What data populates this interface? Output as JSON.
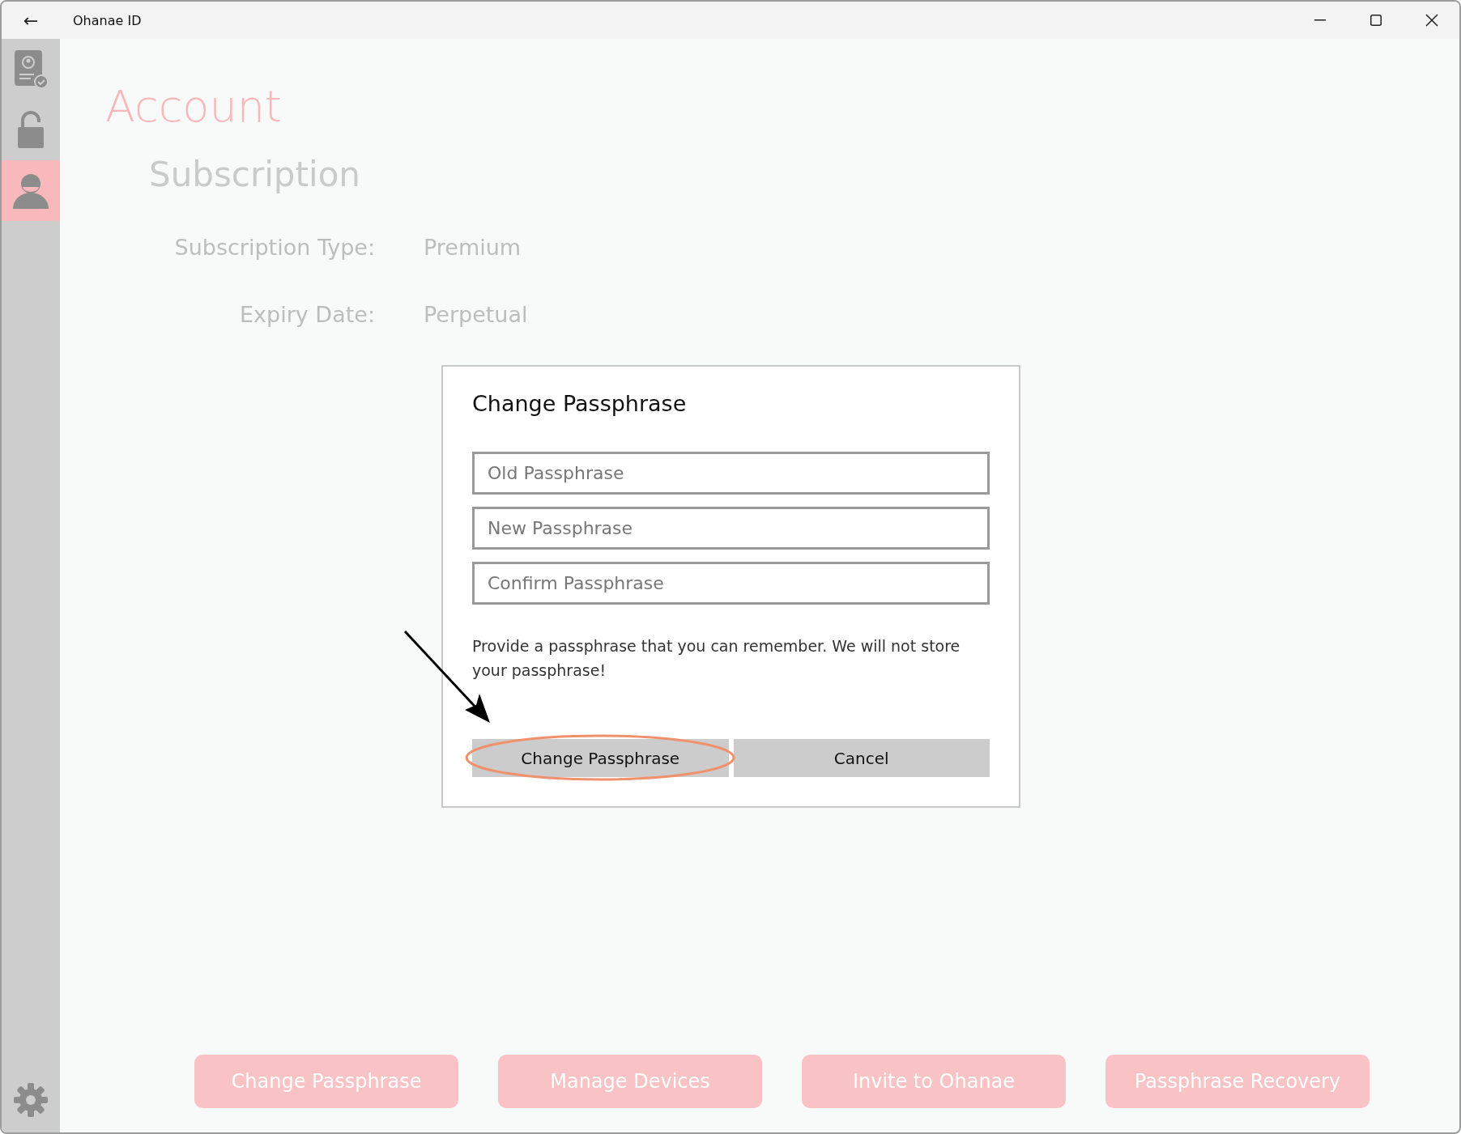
{
  "window": {
    "title": "Ohanae ID",
    "back": "←"
  },
  "sidebar": {
    "items": [
      {
        "kind": "id-card",
        "selected": false
      },
      {
        "kind": "lock",
        "selected": false
      },
      {
        "kind": "person",
        "selected": true
      }
    ]
  },
  "page": {
    "title": "Account",
    "section": "Subscription",
    "fields": [
      {
        "label": "Subscription Type:",
        "value": "Premium"
      },
      {
        "label": "Expiry Date:",
        "value": "Perpetual"
      }
    ]
  },
  "dialog": {
    "title": "Change Passphrase",
    "inputs": [
      {
        "placeholder": "Old Passphrase"
      },
      {
        "placeholder": "New Passphrase"
      },
      {
        "placeholder": "Confirm Passphrase"
      }
    ],
    "note": "Provide a passphrase that you can remember. We will not store your passphrase!",
    "buttons": [
      "Change Passphrase",
      "Cancel"
    ]
  },
  "actions": [
    "Change Passphrase",
    "Manage Devices",
    "Invite to Ohanae",
    "Passphrase Recovery"
  ]
}
